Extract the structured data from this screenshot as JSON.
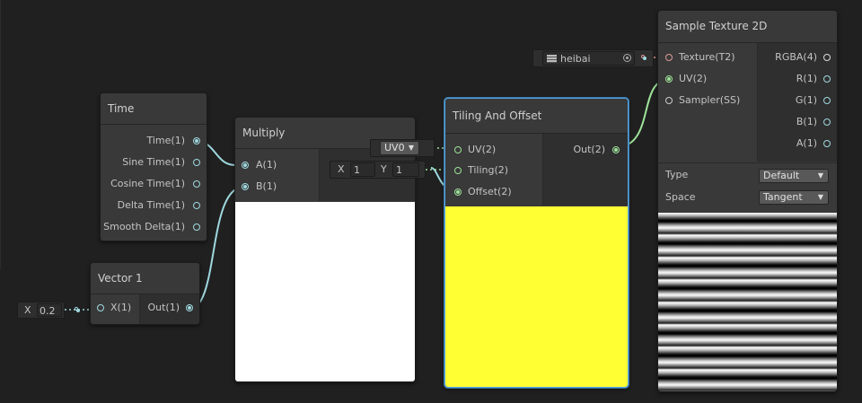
{
  "colors": {
    "background": "#202020",
    "node": "#393939",
    "wire_float": "#9fd9e0",
    "wire_vec2": "#9ee39a",
    "texture_port": "#e09a9a",
    "preview_yellow": "#ffff33",
    "selection": "#57a3dc"
  },
  "time_node": {
    "title": "Time",
    "outputs": [
      "Time(1)",
      "Sine Time(1)",
      "Cosine Time(1)",
      "Delta Time(1)",
      "Smooth Delta(1)"
    ]
  },
  "vector1_node": {
    "title": "Vector 1",
    "input": "X(1)",
    "output": "Out(1)",
    "field_label": "X",
    "field_value": "0.2"
  },
  "multiply_node": {
    "title": "Multiply",
    "inputs": [
      "A(1)",
      "B(1)"
    ]
  },
  "tiling_node": {
    "title": "Tiling And Offset",
    "inputs": [
      "UV(2)",
      "Tiling(2)",
      "Offset(2)"
    ],
    "output": "Out(2)",
    "uv_dropdown": "UV0",
    "tiling_x_label": "X",
    "tiling_x": "1",
    "tiling_y_label": "Y",
    "tiling_y": "1"
  },
  "sample_node": {
    "title": "Sample Texture 2D",
    "inputs": [
      "Texture(T2)",
      "UV(2)",
      "Sampler(SS)"
    ],
    "outputs": [
      "RGBA(4)",
      "R(1)",
      "G(1)",
      "B(1)",
      "A(1)"
    ],
    "type_label": "Type",
    "type_value": "Default",
    "space_label": "Space",
    "space_value": "Tangent",
    "texture_name": "heibai"
  }
}
